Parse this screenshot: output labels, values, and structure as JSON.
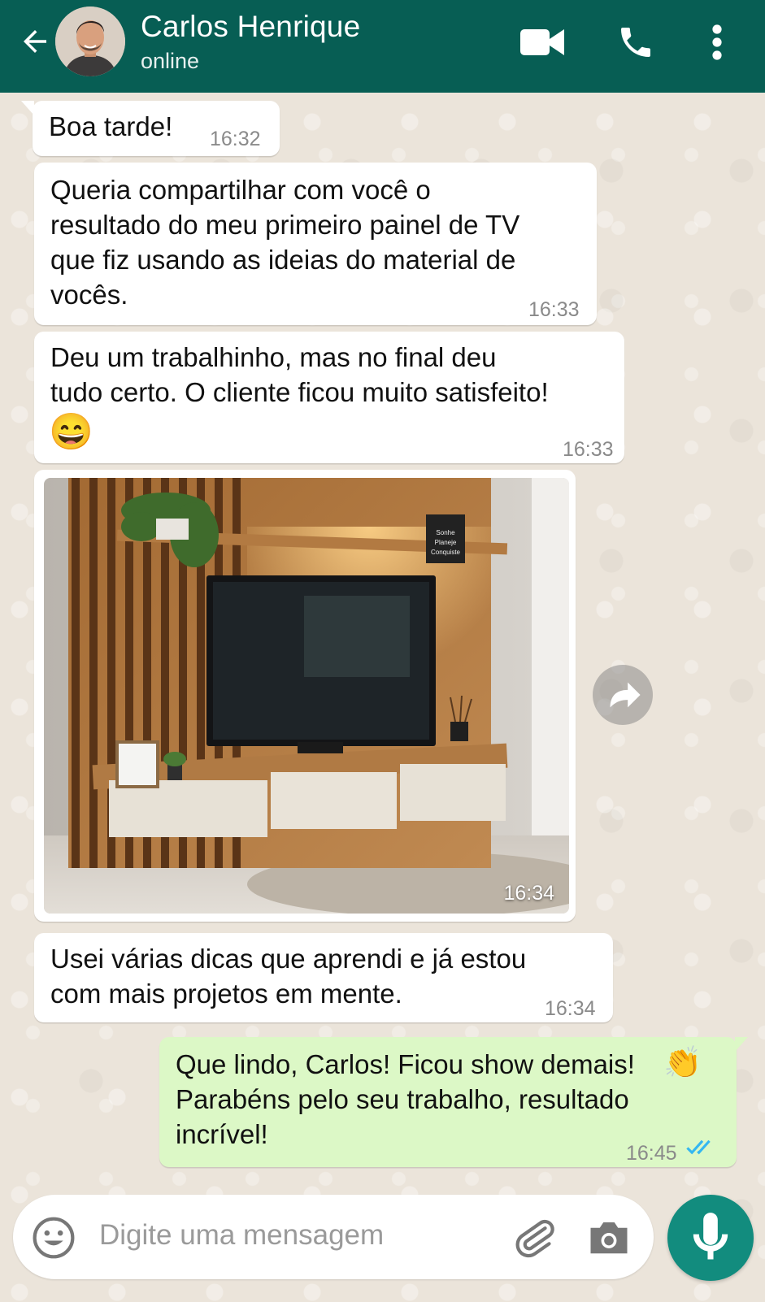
{
  "header": {
    "contact_name": "Carlos Henrique",
    "status": "online"
  },
  "messages": [
    {
      "direction": "in",
      "text": "Boa tarde!",
      "time": "16:32"
    },
    {
      "direction": "in",
      "text": "Queria compartilhar com você o\nresultado do meu primeiro painel de TV\nque fiz usando as ideias do material de\nvocês.",
      "time": "16:33"
    },
    {
      "direction": "in",
      "text": "Deu um trabalhinho, mas no final deu\ntudo certo. O cliente ficou muito satisfeito!",
      "emoji": "😄",
      "time": "16:33"
    },
    {
      "direction": "in",
      "type": "image",
      "time": "16:34",
      "frame_text": "Sonhe\nPlaneje\nConquiste"
    },
    {
      "direction": "in",
      "text": "Usei várias dicas que aprendi e já estou\ncom mais projetos em mente.",
      "time": "16:34"
    },
    {
      "direction": "out",
      "text": "Que lindo, Carlos! Ficou show demais!\nParabéns pelo seu trabalho, resultado\nincrível!",
      "emoji": "👏",
      "time": "16:45",
      "status": "read"
    }
  ],
  "composer": {
    "placeholder": "Digite uma mensagem"
  },
  "colors": {
    "header": "#075e54",
    "outgoing_bubble": "#dcf8c6",
    "incoming_bubble": "#ffffff",
    "mic_button": "#128c7e",
    "read_ticks": "#34b7f1"
  },
  "icons": [
    "back-arrow-icon",
    "video-call-icon",
    "phone-icon",
    "more-vertical-icon",
    "forward-icon",
    "emoji-icon",
    "attach-icon",
    "camera-icon",
    "mic-icon",
    "double-check-icon"
  ]
}
